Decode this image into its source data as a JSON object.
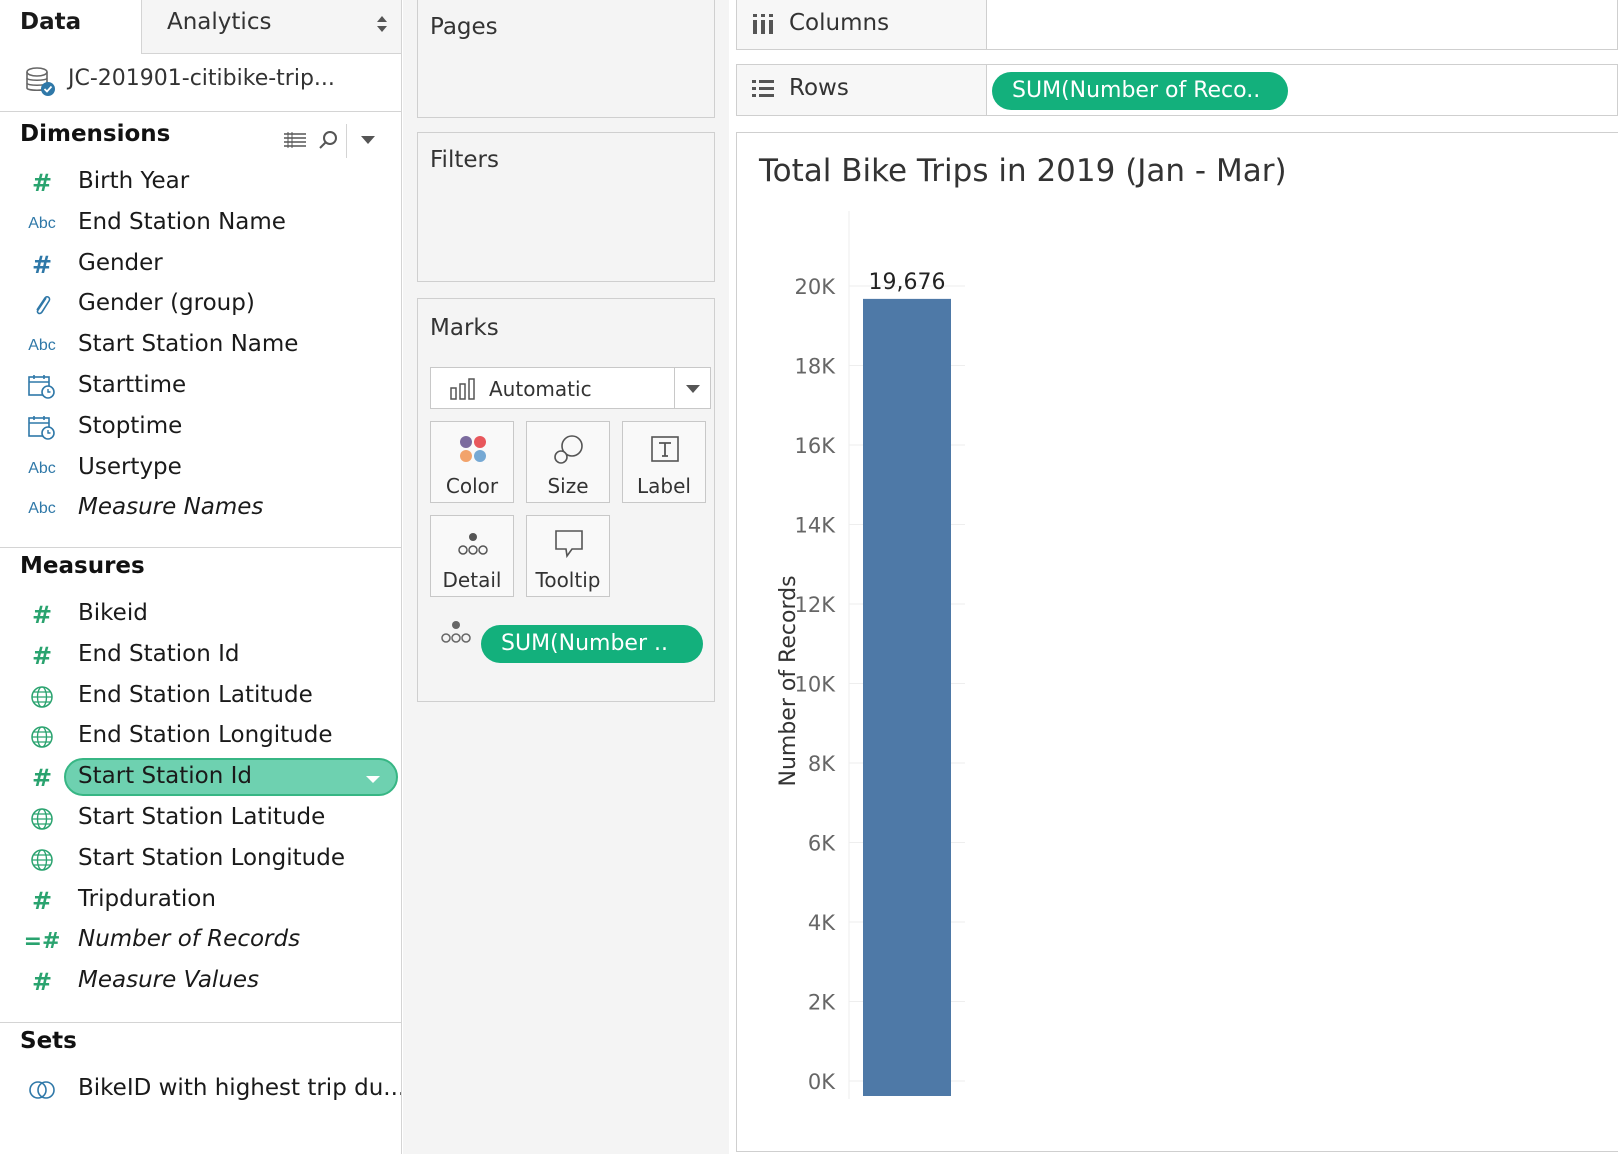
{
  "data_pane": {
    "tab_data": "Data",
    "tab_analytics": "Analytics",
    "datasource": "JC-201901-citibike-trip...",
    "dimensions_header": "Dimensions",
    "dimensions": [
      {
        "label": "Birth Year",
        "type": "number-green",
        "italic": false
      },
      {
        "label": "End Station Name",
        "type": "abc",
        "italic": false
      },
      {
        "label": "Gender",
        "type": "number-blue",
        "italic": false
      },
      {
        "label": "Gender (group)",
        "type": "paperclip",
        "italic": false
      },
      {
        "label": "Start Station Name",
        "type": "abc",
        "italic": false
      },
      {
        "label": "Starttime",
        "type": "datetime",
        "italic": false
      },
      {
        "label": "Stoptime",
        "type": "datetime",
        "italic": false
      },
      {
        "label": "Usertype",
        "type": "abc",
        "italic": false
      },
      {
        "label": "Measure Names",
        "type": "abc",
        "italic": true
      }
    ],
    "measures_header": "Measures",
    "measures": [
      {
        "label": "Bikeid",
        "type": "number-green",
        "italic": false
      },
      {
        "label": "End Station Id",
        "type": "number-green",
        "italic": false
      },
      {
        "label": "End Station Latitude",
        "type": "globe",
        "italic": false
      },
      {
        "label": "End Station Longitude",
        "type": "globe",
        "italic": false
      },
      {
        "label": "Start Station Id",
        "type": "number-green",
        "italic": false,
        "selected": true
      },
      {
        "label": "Start Station Latitude",
        "type": "globe",
        "italic": false
      },
      {
        "label": "Start Station Longitude",
        "type": "globe",
        "italic": false
      },
      {
        "label": "Tripduration",
        "type": "number-green",
        "italic": false
      },
      {
        "label": "Number of Records",
        "type": "calc-number",
        "italic": true
      },
      {
        "label": "Measure Values",
        "type": "number-green",
        "italic": true
      }
    ],
    "sets_header": "Sets",
    "sets": [
      {
        "label": "BikeID with highest trip du...",
        "type": "set"
      }
    ]
  },
  "shelves": {
    "pages": "Pages",
    "filters": "Filters",
    "marks": "Marks",
    "mark_type": "Automatic",
    "mark_buttons": {
      "color": "Color",
      "size": "Size",
      "label": "Label",
      "detail": "Detail",
      "tooltip": "Tooltip"
    },
    "marks_pill": "SUM(Number ..",
    "columns": "Columns",
    "rows": "Rows",
    "rows_pill": "SUM(Number of Reco.."
  },
  "colors": {
    "bar": "#4e79a7",
    "pill_green": "#13b07c",
    "selected_field": "#6ed1b0",
    "icon_green": "#2aa36f",
    "icon_blue": "#2f78a8"
  },
  "viz": {
    "title": "Total Bike Trips in 2019 (Jan - Mar)"
  },
  "chart_data": {
    "type": "bar",
    "title": "Total Bike Trips in 2019 (Jan - Mar)",
    "xlabel": "",
    "ylabel": "Number of Records",
    "categories": [
      ""
    ],
    "values": [
      19676
    ],
    "data_labels": [
      "19,676"
    ],
    "ylim": [
      0,
      20000
    ],
    "y_ticks": [
      0,
      2000,
      4000,
      6000,
      8000,
      10000,
      12000,
      14000,
      16000,
      18000,
      20000
    ],
    "y_tick_labels": [
      "0K",
      "2K",
      "4K",
      "6K",
      "8K",
      "10K",
      "12K",
      "14K",
      "16K",
      "18K",
      "20K"
    ],
    "grid": true,
    "legend": "none"
  }
}
